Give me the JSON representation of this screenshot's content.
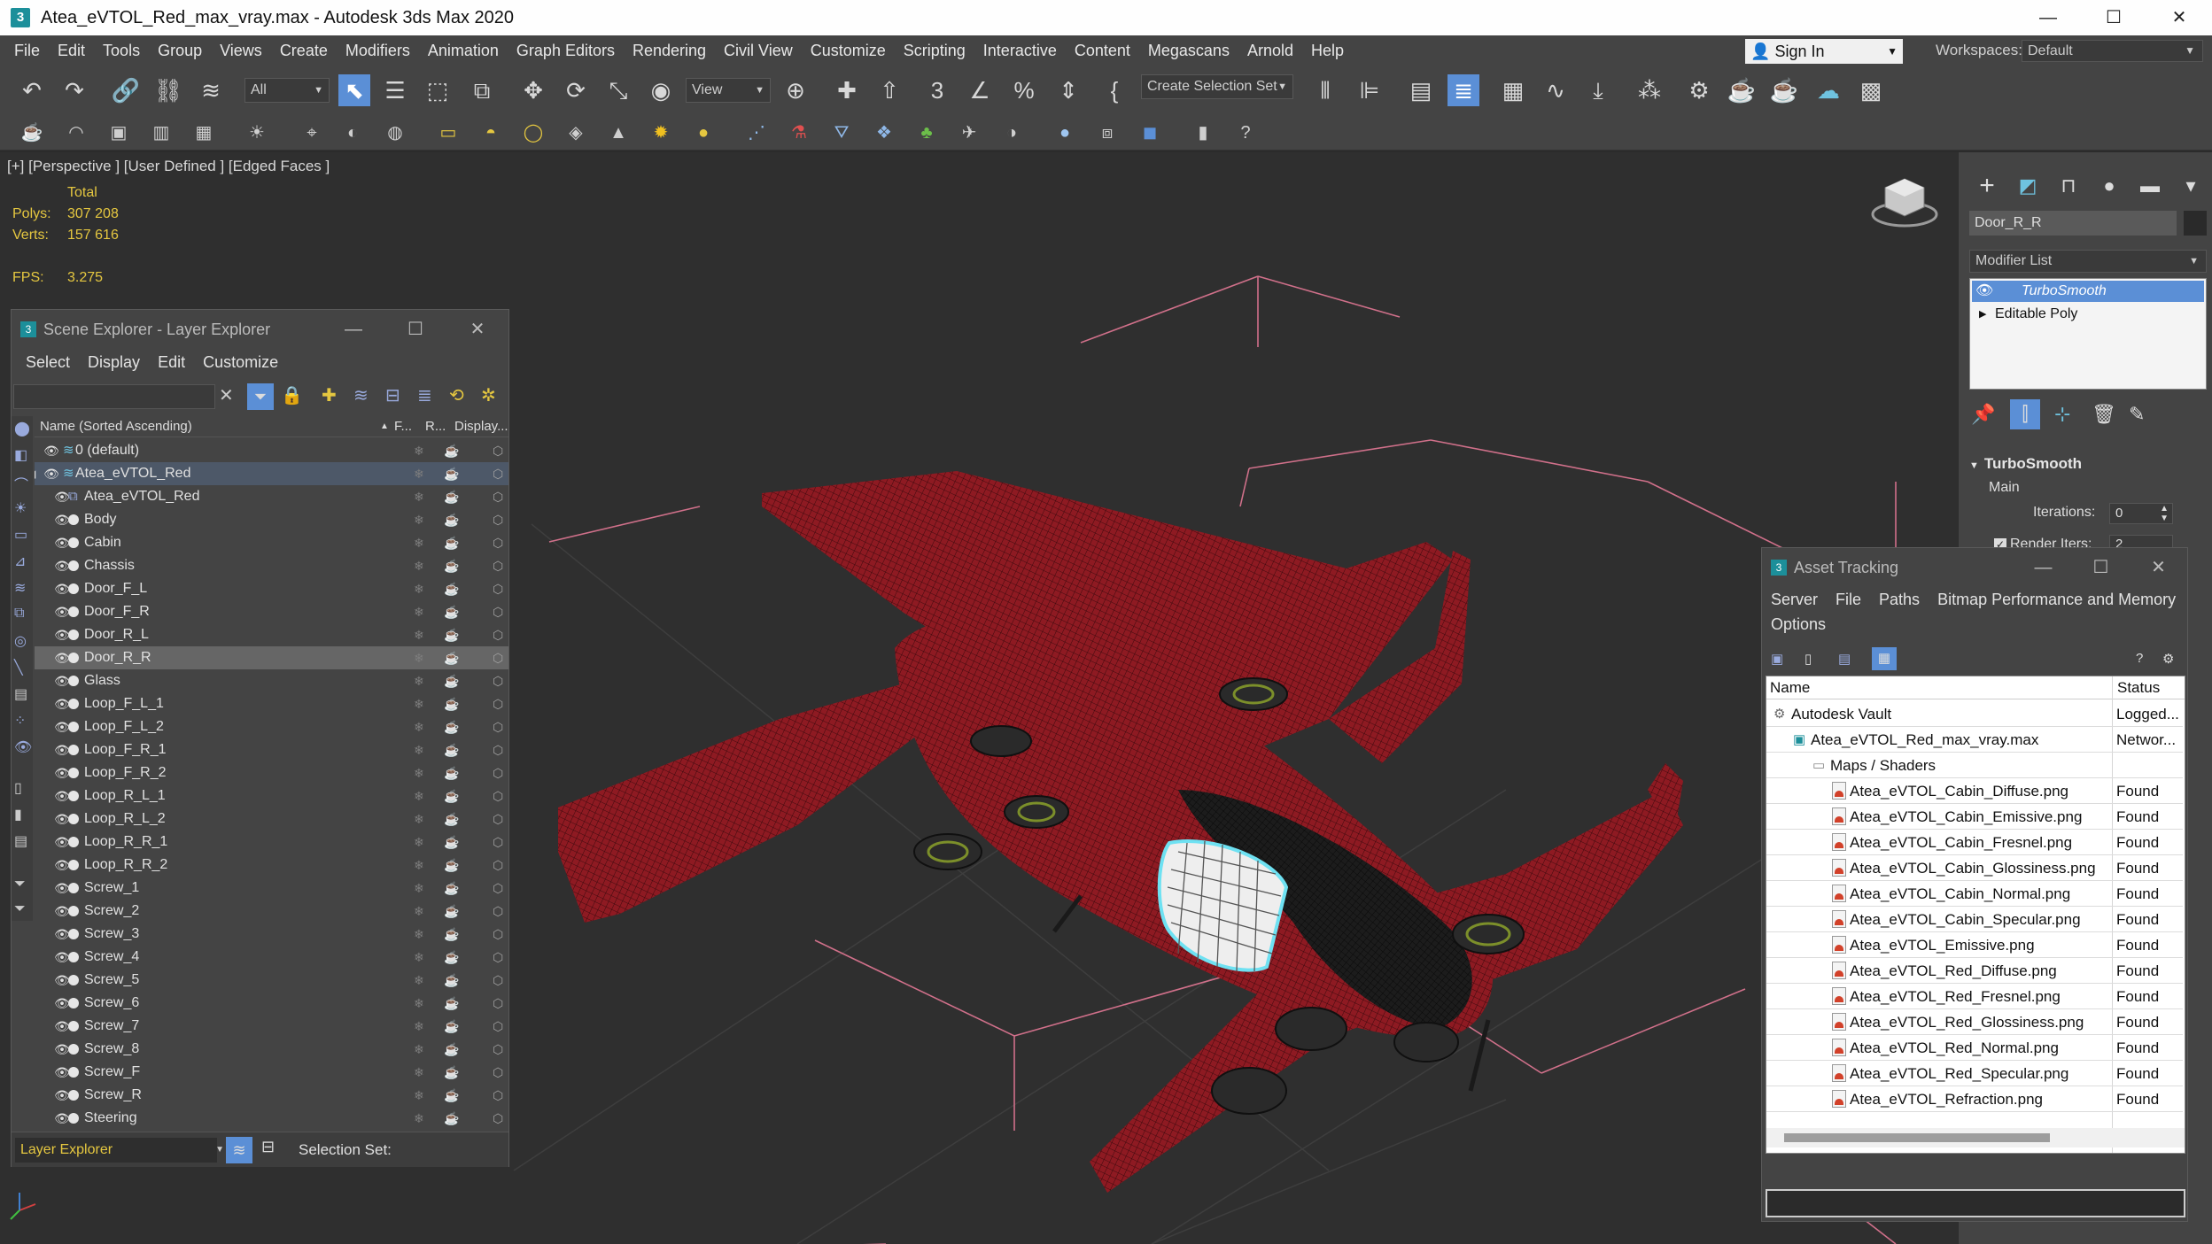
{
  "window": {
    "title": "Atea_eVTOL_Red_max_vray.max - Autodesk 3ds Max 2020",
    "app_icon": "3",
    "minimize": "—",
    "maximize": "☐",
    "close": "✕"
  },
  "menu": {
    "items": [
      "File",
      "Edit",
      "Tools",
      "Group",
      "Views",
      "Create",
      "Modifiers",
      "Animation",
      "Graph Editors",
      "Rendering",
      "Civil View",
      "Customize",
      "Scripting",
      "Interactive",
      "Content",
      "Megascans",
      "Arnold",
      "Help"
    ],
    "sign_in": "Sign In",
    "workspaces_label": "Workspaces:",
    "workspace_value": "Default"
  },
  "toolbar": {
    "selection_filter": "All",
    "reference_coord": "View",
    "selection_set": "Create Selection Set"
  },
  "viewport": {
    "label": "[+] [Perspective ] [User Defined ] [Edged Faces ]",
    "stats_header": "Total",
    "polys_label": "Polys:",
    "polys_value": "307 208",
    "verts_label": "Verts:",
    "verts_value": "157 616",
    "fps_label": "FPS:",
    "fps_value": "3.275"
  },
  "scene_explorer": {
    "title": "Scene Explorer - Layer Explorer",
    "menu": [
      "Select",
      "Display",
      "Edit",
      "Customize"
    ],
    "col_name": "Name (Sorted Ascending)",
    "col_f": "F...",
    "col_r": "R...",
    "col_display": "Display...",
    "rows": [
      {
        "name": "0 (default)",
        "level": 0,
        "kind": "layer"
      },
      {
        "name": "Atea_eVTOL_Red",
        "level": 0,
        "kind": "layer-active"
      },
      {
        "name": "Atea_eVTOL_Red",
        "level": 1,
        "kind": "group"
      },
      {
        "name": "Body",
        "level": 1,
        "kind": "object"
      },
      {
        "name": "Cabin",
        "level": 1,
        "kind": "object"
      },
      {
        "name": "Chassis",
        "level": 1,
        "kind": "object"
      },
      {
        "name": "Door_F_L",
        "level": 1,
        "kind": "object"
      },
      {
        "name": "Door_F_R",
        "level": 1,
        "kind": "object"
      },
      {
        "name": "Door_R_L",
        "level": 1,
        "kind": "object"
      },
      {
        "name": "Door_R_R",
        "level": 1,
        "kind": "selected"
      },
      {
        "name": "Glass",
        "level": 1,
        "kind": "object"
      },
      {
        "name": "Loop_F_L_1",
        "level": 1,
        "kind": "object"
      },
      {
        "name": "Loop_F_L_2",
        "level": 1,
        "kind": "object"
      },
      {
        "name": "Loop_F_R_1",
        "level": 1,
        "kind": "object"
      },
      {
        "name": "Loop_F_R_2",
        "level": 1,
        "kind": "object"
      },
      {
        "name": "Loop_R_L_1",
        "level": 1,
        "kind": "object"
      },
      {
        "name": "Loop_R_L_2",
        "level": 1,
        "kind": "object"
      },
      {
        "name": "Loop_R_R_1",
        "level": 1,
        "kind": "object"
      },
      {
        "name": "Loop_R_R_2",
        "level": 1,
        "kind": "object"
      },
      {
        "name": "Screw_1",
        "level": 1,
        "kind": "object"
      },
      {
        "name": "Screw_2",
        "level": 1,
        "kind": "object"
      },
      {
        "name": "Screw_3",
        "level": 1,
        "kind": "object"
      },
      {
        "name": "Screw_4",
        "level": 1,
        "kind": "object"
      },
      {
        "name": "Screw_5",
        "level": 1,
        "kind": "object"
      },
      {
        "name": "Screw_6",
        "level": 1,
        "kind": "object"
      },
      {
        "name": "Screw_7",
        "level": 1,
        "kind": "object"
      },
      {
        "name": "Screw_8",
        "level": 1,
        "kind": "object"
      },
      {
        "name": "Screw_F",
        "level": 1,
        "kind": "object"
      },
      {
        "name": "Screw_R",
        "level": 1,
        "kind": "object"
      },
      {
        "name": "Steering",
        "level": 1,
        "kind": "object"
      }
    ],
    "footer_explorer": "Layer Explorer",
    "footer_selection_set": "Selection Set:"
  },
  "command_panel": {
    "object_name": "Door_R_R",
    "modifier_list": "Modifier List",
    "stack": [
      {
        "name": "TurboSmooth",
        "active": true
      },
      {
        "name": "Editable Poly",
        "active": false
      }
    ],
    "rollout_title": "TurboSmooth",
    "rollout_group": "Main",
    "iterations_label": "Iterations:",
    "iterations_value": "0",
    "render_iters_label": "Render Iters:",
    "render_iters_value": "2"
  },
  "asset_tracking": {
    "title": "Asset Tracking",
    "menu": [
      "Server",
      "File",
      "Paths",
      "Bitmap Performance and Memory",
      "Options"
    ],
    "col_name": "Name",
    "col_status": "Status",
    "rows": [
      {
        "name": "Autodesk Vault",
        "status": "Logged...",
        "level": 0,
        "icon": "vault"
      },
      {
        "name": "Atea_eVTOL_Red_max_vray.max",
        "status": "Networ...",
        "level": 1,
        "icon": "max"
      },
      {
        "name": "Maps / Shaders",
        "status": "",
        "level": 2,
        "icon": "folder"
      },
      {
        "name": "Atea_eVTOL_Cabin_Diffuse.png",
        "status": "Found",
        "level": 3,
        "icon": "image"
      },
      {
        "name": "Atea_eVTOL_Cabin_Emissive.png",
        "status": "Found",
        "level": 3,
        "icon": "image"
      },
      {
        "name": "Atea_eVTOL_Cabin_Fresnel.png",
        "status": "Found",
        "level": 3,
        "icon": "image"
      },
      {
        "name": "Atea_eVTOL_Cabin_Glossiness.png",
        "status": "Found",
        "level": 3,
        "icon": "image"
      },
      {
        "name": "Atea_eVTOL_Cabin_Normal.png",
        "status": "Found",
        "level": 3,
        "icon": "image"
      },
      {
        "name": "Atea_eVTOL_Cabin_Specular.png",
        "status": "Found",
        "level": 3,
        "icon": "image"
      },
      {
        "name": "Atea_eVTOL_Emissive.png",
        "status": "Found",
        "level": 3,
        "icon": "image"
      },
      {
        "name": "Atea_eVTOL_Red_Diffuse.png",
        "status": "Found",
        "level": 3,
        "icon": "image"
      },
      {
        "name": "Atea_eVTOL_Red_Fresnel.png",
        "status": "Found",
        "level": 3,
        "icon": "image"
      },
      {
        "name": "Atea_eVTOL_Red_Glossiness.png",
        "status": "Found",
        "level": 3,
        "icon": "image"
      },
      {
        "name": "Atea_eVTOL_Red_Normal.png",
        "status": "Found",
        "level": 3,
        "icon": "image"
      },
      {
        "name": "Atea_eVTOL_Red_Specular.png",
        "status": "Found",
        "level": 3,
        "icon": "image"
      },
      {
        "name": "Atea_eVTOL_Refraction.png",
        "status": "Found",
        "level": 3,
        "icon": "image"
      }
    ]
  },
  "colors": {
    "ui_bg": "#444444",
    "viewport_bg": "#2f2f2f",
    "stats_yellow": "#e5c740",
    "selection_blue": "#5b8fd6",
    "model_red": "#8e1a22",
    "bounding_box": "#d0708a"
  }
}
